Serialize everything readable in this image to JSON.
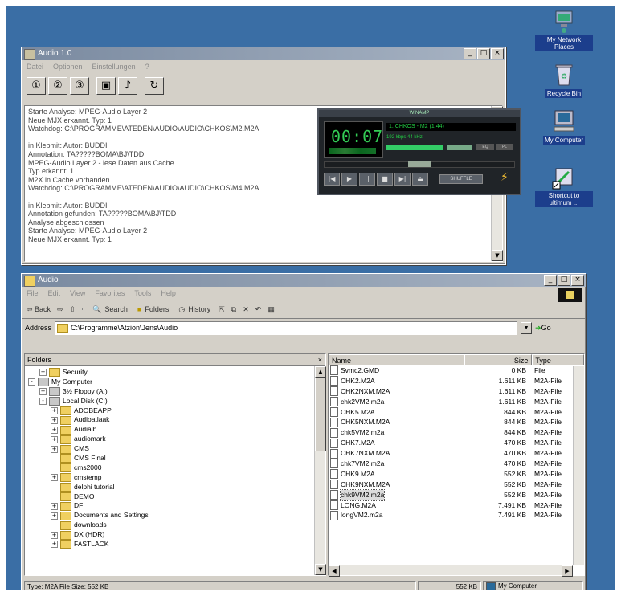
{
  "audio_window": {
    "title": "Audio 1.0",
    "menu": [
      "Datei",
      "Optionen",
      "Einstellungen",
      "?"
    ],
    "window_controls": [
      "_",
      "□",
      "×"
    ],
    "toolbar": [
      "①",
      "②",
      "③",
      "▣",
      "♪",
      "↻"
    ],
    "log_lines": [
      "Starte Analyse: MPEG-Audio Layer 2",
      "Neue MJX erkannt. Typ: 1",
      "Watchdog: C:\\PROGRAMME\\ATEDEN\\AUDIO\\AUDIO\\CHKOS\\M2.M2A",
      "",
      "in Klebmit: Autor: BUDDI",
      "Annotation: TA?????BOMA\\BJ\\TDD",
      "MPEG-Audio Layer 2 - lese Daten aus Cache",
      "Typ erkannt: 1",
      "M2X in Cache vorhanden",
      "Watchdog: C:\\PROGRAMME\\ATEDEN\\AUDIO\\AUDIO\\CHKOS\\M4.M2A",
      "",
      "in Klebmit: Autor: BUDDI",
      "Annotation gefunden: TA?????BOMA\\BJ\\TDD",
      "Analyse abgeschlossen",
      "Starte Analyse: MPEG-Audio Layer 2",
      "Neue MJX erkannt. Typ: 1"
    ]
  },
  "winamp": {
    "title": "WINAMP",
    "time": "00:07",
    "song": "1. CHKOS - M2 (1:44)",
    "kbps": "192 kbps  44 kHz",
    "eq_buttons": [
      "EQ",
      "PL"
    ],
    "controls": [
      "|◀",
      "▶",
      "||",
      "■",
      "▶|",
      "⏏"
    ],
    "shuffle": "SHUFFLE",
    "progress": 0.5
  },
  "desktop_icons": [
    {
      "label": "My Network Places",
      "icon": "network-icon"
    },
    {
      "label": "Recycle Bin",
      "icon": "recycle-bin-icon"
    },
    {
      "label": "My Computer",
      "icon": "computer-icon"
    },
    {
      "label": "Shortcut to ultimum ...",
      "icon": "shortcut-icon"
    }
  ],
  "explorer": {
    "title": "Audio",
    "menu": [
      "File",
      "Edit",
      "View",
      "Favorites",
      "Tools",
      "Help"
    ],
    "toolbar": {
      "back": "⇦ Back",
      "forward": "⇨",
      "up": "⇧",
      "search": "Search",
      "folders": "Folders",
      "history": "History",
      "views": "▦"
    },
    "address_label": "Address",
    "address": "C:\\Programme\\Atzion\\Jens\\Audio",
    "go_label": "Go",
    "folders_pane_title": "Folders",
    "tree": [
      {
        "label": "Security",
        "indent": 1,
        "exp": "+",
        "drive": false
      },
      {
        "label": "My Computer",
        "indent": 0,
        "exp": "-",
        "drive": true
      },
      {
        "label": "3½ Floppy (A:)",
        "indent": 1,
        "exp": "+",
        "drive": true
      },
      {
        "label": "Local Disk (C:)",
        "indent": 1,
        "exp": "-",
        "drive": true
      },
      {
        "label": "ADOBEAPP",
        "indent": 2,
        "exp": "+",
        "drive": false
      },
      {
        "label": "Audioatlaak",
        "indent": 2,
        "exp": "+",
        "drive": false
      },
      {
        "label": "Audialb",
        "indent": 2,
        "exp": "+",
        "drive": false
      },
      {
        "label": "audiomark",
        "indent": 2,
        "exp": "+",
        "drive": false
      },
      {
        "label": "CMS",
        "indent": 2,
        "exp": "+",
        "drive": false
      },
      {
        "label": "CMS Final",
        "indent": 2,
        "exp": "",
        "drive": false
      },
      {
        "label": "cms2000",
        "indent": 2,
        "exp": "",
        "drive": false
      },
      {
        "label": "cmstemp",
        "indent": 2,
        "exp": "+",
        "drive": false
      },
      {
        "label": "delphi tutorial",
        "indent": 2,
        "exp": "",
        "drive": false
      },
      {
        "label": "DEMO",
        "indent": 2,
        "exp": "",
        "drive": false
      },
      {
        "label": "DF",
        "indent": 2,
        "exp": "+",
        "drive": false
      },
      {
        "label": "Documents and Settings",
        "indent": 2,
        "exp": "+",
        "drive": false
      },
      {
        "label": "downloads",
        "indent": 2,
        "exp": "",
        "drive": false
      },
      {
        "label": "DX (HDR)",
        "indent": 2,
        "exp": "+",
        "drive": false
      },
      {
        "label": "FASTLACK",
        "indent": 2,
        "exp": "+",
        "drive": false
      }
    ],
    "columns": [
      "Name",
      "Size",
      "Type"
    ],
    "files": [
      {
        "name": "Svmc2.GMD",
        "size": "0 KB",
        "type": "File"
      },
      {
        "name": "CHK2.M2A",
        "size": "1.611 KB",
        "type": "M2A-File"
      },
      {
        "name": "CHK2NXM.M2A",
        "size": "1.611 KB",
        "type": "M2A-File"
      },
      {
        "name": "chk2VM2.m2a",
        "size": "1.611 KB",
        "type": "M2A-File"
      },
      {
        "name": "CHK5.M2A",
        "size": "844 KB",
        "type": "M2A-File"
      },
      {
        "name": "CHK5NXM.M2A",
        "size": "844 KB",
        "type": "M2A-File"
      },
      {
        "name": "chk5VM2.m2a",
        "size": "844 KB",
        "type": "M2A-File"
      },
      {
        "name": "CHK7.M2A",
        "size": "470 KB",
        "type": "M2A-File"
      },
      {
        "name": "CHK7NXM.M2A",
        "size": "470 KB",
        "type": "M2A-File"
      },
      {
        "name": "chk7VM2.m2a",
        "size": "470 KB",
        "type": "M2A-File"
      },
      {
        "name": "CHK9.M2A",
        "size": "552 KB",
        "type": "M2A-File"
      },
      {
        "name": "CHK9NXM.M2A",
        "size": "552 KB",
        "type": "M2A-File"
      },
      {
        "name": "chk9VM2.m2a",
        "size": "552 KB",
        "type": "M2A-File",
        "selected": true
      },
      {
        "name": "LONG.M2A",
        "size": "7.491 KB",
        "type": "M2A-File"
      },
      {
        "name": "longVM2.m2a",
        "size": "7.491 KB",
        "type": "M2A-File"
      }
    ],
    "status": {
      "info": "Type: M2A File Size: 552 KB",
      "size": "552 KB",
      "location": "My Computer"
    }
  }
}
